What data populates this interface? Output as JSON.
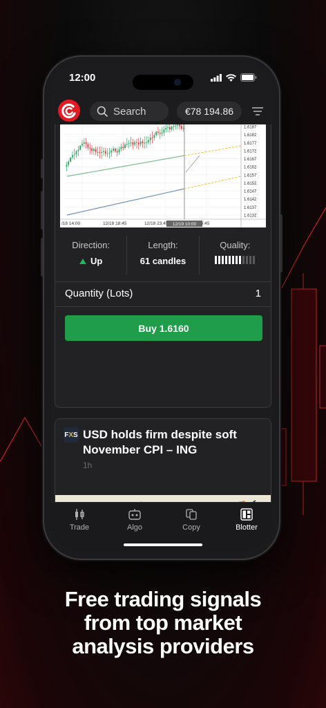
{
  "status_bar": {
    "time": "12:00"
  },
  "topbar": {
    "search_label": "Search",
    "balance": "€78 194.86"
  },
  "chart": {
    "price_ticks": [
      "1.6187",
      "1.6182",
      "1.6177",
      "1.6172",
      "1.6167",
      "1.6162",
      "1.6157",
      "1.6152",
      "1.6147",
      "1.6142",
      "1.6137",
      "1.6132"
    ],
    "time_ticks": [
      "/18 14:00",
      "12/18 18:45",
      "12/18 23:45",
      "12/19 04:45"
    ],
    "cursor_label": "12/19 10:00",
    "colors": {
      "up": "#26a65b",
      "down": "#d93a3a",
      "upper_channel": "#7cbf8f",
      "lower_channel": "#6a8fb5",
      "projection": "#f2c63a"
    }
  },
  "signal": {
    "direction_label": "Direction:",
    "direction_value": "Up",
    "length_label": "Length:",
    "length_value": "61 candles",
    "quality_label": "Quality:",
    "quality_level": 0.67,
    "quantity_label": "Quantity (Lots)",
    "quantity_value": "1",
    "buy_label": "Buy 1.6160"
  },
  "news": {
    "source_logo_text": "FXS",
    "title": "USD holds firm despite soft November CPI – ING",
    "time": "1h"
  },
  "tabs": [
    {
      "label": "Trade",
      "icon": "candlestick-icon"
    },
    {
      "label": "Algo",
      "icon": "robot-icon"
    },
    {
      "label": "Copy",
      "icon": "copy-icon"
    },
    {
      "label": "Blotter",
      "icon": "blotter-icon"
    }
  ],
  "headline": {
    "line1": "Free trading signals",
    "line2": "from top market",
    "line3": "analysis providers"
  },
  "colors": {
    "brand": "#e21b24",
    "buy": "#1f9d4a",
    "background": "#0b0b0b"
  }
}
